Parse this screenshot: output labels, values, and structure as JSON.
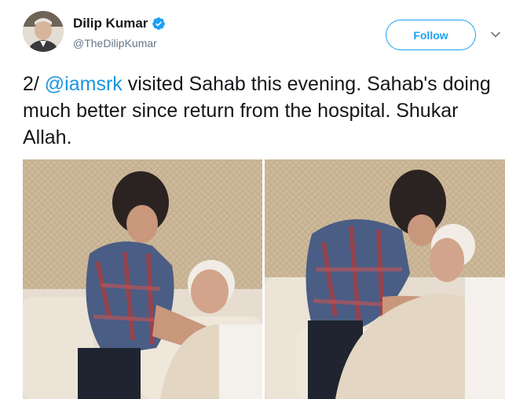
{
  "author": {
    "name": "Dilip Kumar",
    "handle": "@TheDilipKumar",
    "verified": true
  },
  "follow_button": {
    "label": "Follow"
  },
  "tweet": {
    "prefix": "2/ ",
    "mention": "@iamsrk",
    "body": " visited Sahab this evening. Sahab's doing much better since return from the hospital. Shukar Allah."
  },
  "media": [
    {
      "kind": "photo"
    },
    {
      "kind": "photo"
    }
  ],
  "colors": {
    "accent": "#1da1f2",
    "link": "#1b95e0",
    "text": "#14171a",
    "secondary_text": "#657786"
  },
  "icons": {
    "verified": "verified-badge-icon",
    "menu": "chevron-down-icon"
  }
}
